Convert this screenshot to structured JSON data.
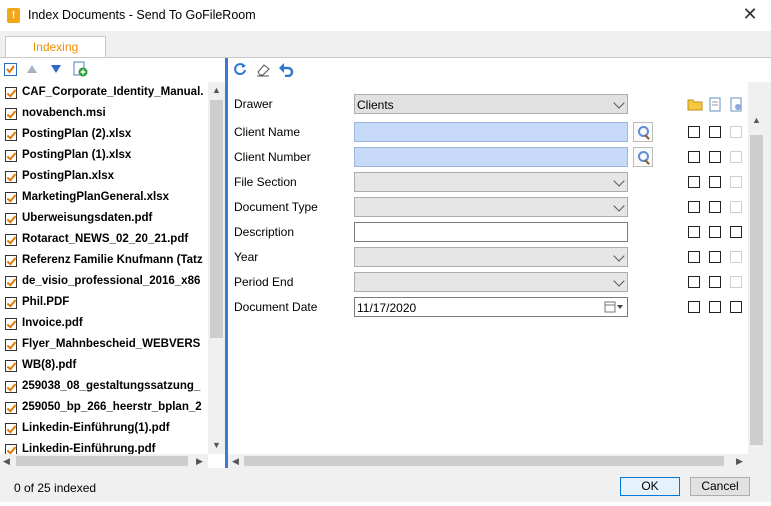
{
  "window": {
    "title": "Index Documents - Send To GoFileRoom",
    "close_glyph": "✕"
  },
  "tabs": [
    {
      "label": "Indexing",
      "active": true
    }
  ],
  "files": [
    "CAF_Corporate_Identity_Manual.",
    "novabench.msi",
    "PostingPlan (2).xlsx",
    "PostingPlan (1).xlsx",
    "PostingPlan.xlsx",
    "MarketingPlanGeneral.xlsx",
    "Überweisungsdaten.pdf",
    "Rotaract_NEWS_02_20_21.pdf",
    "Referenz Familie Knufmann (Tatz",
    "de_visio_professional_2016_x86",
    "Phil.PDF",
    "Invoice.pdf",
    "Flyer_Mahnbescheid_WEBVERS",
    "WB(8).pdf",
    "259038_08_gestaltungssatzung_",
    "259050_bp_266_heerstr_bplan_2",
    "Linkedin-Einführung(1).pdf",
    "Linkedin-Einführung.pdf"
  ],
  "fields": [
    {
      "label": "Drawer",
      "type": "combo",
      "value": "Clients",
      "enabled": true
    },
    {
      "label": "Client Name",
      "type": "lookup",
      "value": ""
    },
    {
      "label": "Client Number",
      "type": "lookup",
      "value": ""
    },
    {
      "label": "File Section",
      "type": "combo",
      "value": "",
      "enabled": false
    },
    {
      "label": "Document Type",
      "type": "combo",
      "value": "",
      "enabled": false
    },
    {
      "label": "Description",
      "type": "text",
      "value": ""
    },
    {
      "label": "Year",
      "type": "combo",
      "value": "",
      "enabled": false
    },
    {
      "label": "Period End",
      "type": "combo",
      "value": "",
      "enabled": false
    },
    {
      "label": "Document Date",
      "type": "date",
      "value": "11/17/2020"
    }
  ],
  "status": {
    "text": "0 of 25 indexed"
  },
  "buttons": {
    "ok": "OK",
    "cancel": "Cancel"
  },
  "icons": {
    "left_toolbar": [
      "select-all-checkbox-icon",
      "move-up-arrow-icon",
      "move-down-arrow-icon",
      "add-document-icon"
    ],
    "right_toolbar": [
      "refresh-icon",
      "eraser-icon",
      "undo-icon"
    ],
    "column_headers": [
      "folder-icon",
      "document-icon",
      "document-settings-icon",
      "calendar-icon"
    ]
  },
  "colors": {
    "tab_accent": "#f18d00",
    "check_accent": "#e07a00",
    "splitter": "#3c7ad6",
    "lookup_fill": "#c6daf8"
  }
}
